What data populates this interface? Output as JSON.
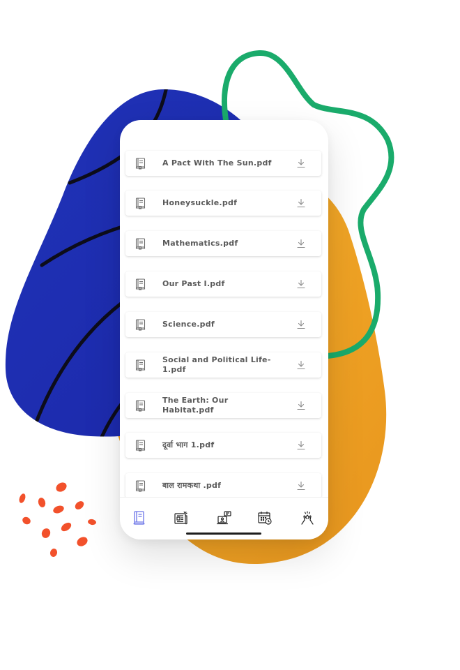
{
  "files": [
    {
      "name": "A Pact With The Sun.pdf",
      "icon": "book-icon"
    },
    {
      "name": "Honeysuckle.pdf",
      "icon": "book-icon"
    },
    {
      "name": "Mathematics.pdf",
      "icon": "book-icon"
    },
    {
      "name": "Our Past I.pdf",
      "icon": "book-icon"
    },
    {
      "name": "Science.pdf",
      "icon": "book-icon"
    },
    {
      "name": "Social and Political Life-1.pdf",
      "icon": "book-icon"
    },
    {
      "name": "The Earth: Our Habitat.pdf",
      "icon": "book-icon"
    },
    {
      "name": "दूर्वा भाग 1.pdf",
      "icon": "book-icon"
    },
    {
      "name": "बाल रामकथा .pdf",
      "icon": "book-icon"
    }
  ],
  "tabs": [
    {
      "icon": "books-icon",
      "active": true
    },
    {
      "icon": "newspaper-icon",
      "active": false
    },
    {
      "icon": "online-class-icon",
      "active": false
    },
    {
      "icon": "calendar-icon",
      "active": false
    },
    {
      "icon": "high-five-icon",
      "active": false
    }
  ],
  "colors": {
    "blue_blob": "#2230b8",
    "orange_blob": "#f4a623",
    "green_loop": "#1aab6b",
    "red_splatter": "#f2512b",
    "active_tab": "#6b74e8",
    "text": "#5a5a5a"
  }
}
